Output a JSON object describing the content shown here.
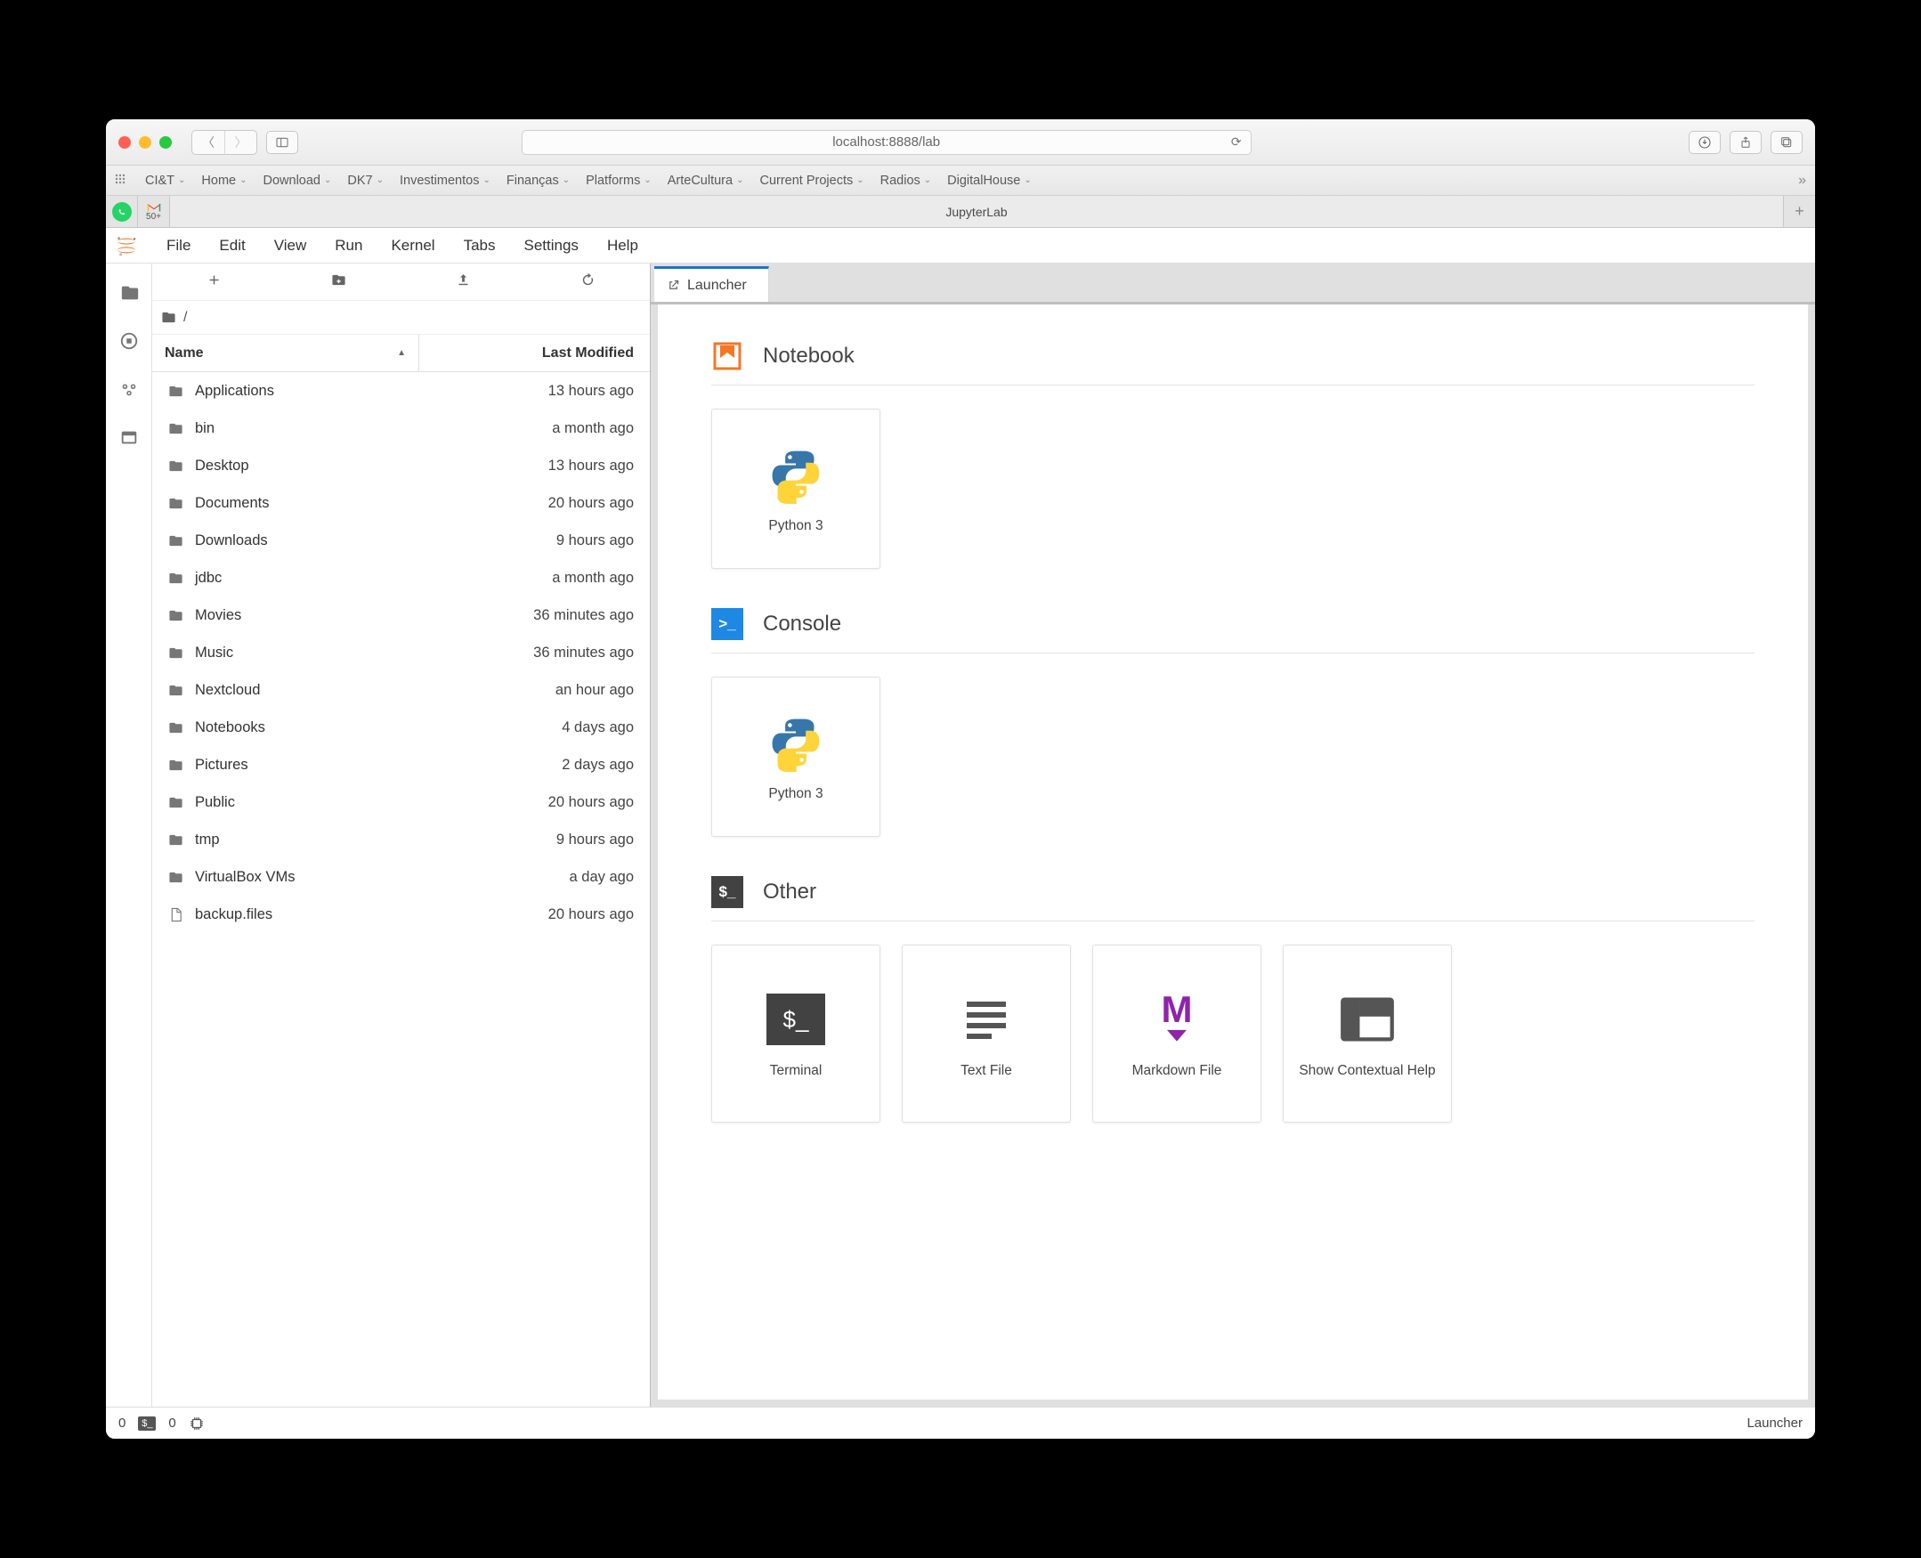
{
  "browser": {
    "url": "localhost:8888/lab",
    "bookmarks": [
      "CI&T",
      "Home",
      "Download",
      "DK7",
      "Investimentos",
      "Finanças",
      "Platforms",
      "ArteCultura",
      "Current Projects",
      "Radios",
      "DigitalHouse"
    ],
    "gmail_badge": "50+",
    "tab_title": "JupyterLab"
  },
  "menubar": [
    "File",
    "Edit",
    "View",
    "Run",
    "Kernel",
    "Tabs",
    "Settings",
    "Help"
  ],
  "filebrowser": {
    "path": "/",
    "col_name": "Name",
    "col_mod": "Last Modified",
    "items": [
      {
        "name": "Applications",
        "type": "folder",
        "mod": "13 hours ago"
      },
      {
        "name": "bin",
        "type": "folder",
        "mod": "a month ago"
      },
      {
        "name": "Desktop",
        "type": "folder",
        "mod": "13 hours ago"
      },
      {
        "name": "Documents",
        "type": "folder",
        "mod": "20 hours ago"
      },
      {
        "name": "Downloads",
        "type": "folder",
        "mod": "9 hours ago"
      },
      {
        "name": "jdbc",
        "type": "folder",
        "mod": "a month ago"
      },
      {
        "name": "Movies",
        "type": "folder",
        "mod": "36 minutes ago"
      },
      {
        "name": "Music",
        "type": "folder",
        "mod": "36 minutes ago"
      },
      {
        "name": "Nextcloud",
        "type": "folder",
        "mod": "an hour ago"
      },
      {
        "name": "Notebooks",
        "type": "folder",
        "mod": "4 days ago"
      },
      {
        "name": "Pictures",
        "type": "folder",
        "mod": "2 days ago"
      },
      {
        "name": "Public",
        "type": "folder",
        "mod": "20 hours ago"
      },
      {
        "name": "tmp",
        "type": "folder",
        "mod": "9 hours ago"
      },
      {
        "name": "VirtualBox VMs",
        "type": "folder",
        "mod": "a day ago"
      },
      {
        "name": "backup.files",
        "type": "file",
        "mod": "20 hours ago"
      }
    ]
  },
  "launcher": {
    "tab_label": "Launcher",
    "sections": {
      "notebook": {
        "title": "Notebook",
        "cards": [
          "Python 3"
        ]
      },
      "console": {
        "title": "Console",
        "cards": [
          "Python 3"
        ]
      },
      "other": {
        "title": "Other",
        "cards": [
          "Terminal",
          "Text File",
          "Markdown File",
          "Show Contextual Help"
        ]
      }
    }
  },
  "statusbar": {
    "terminals": "0",
    "kernels": "0",
    "right": "Launcher"
  }
}
